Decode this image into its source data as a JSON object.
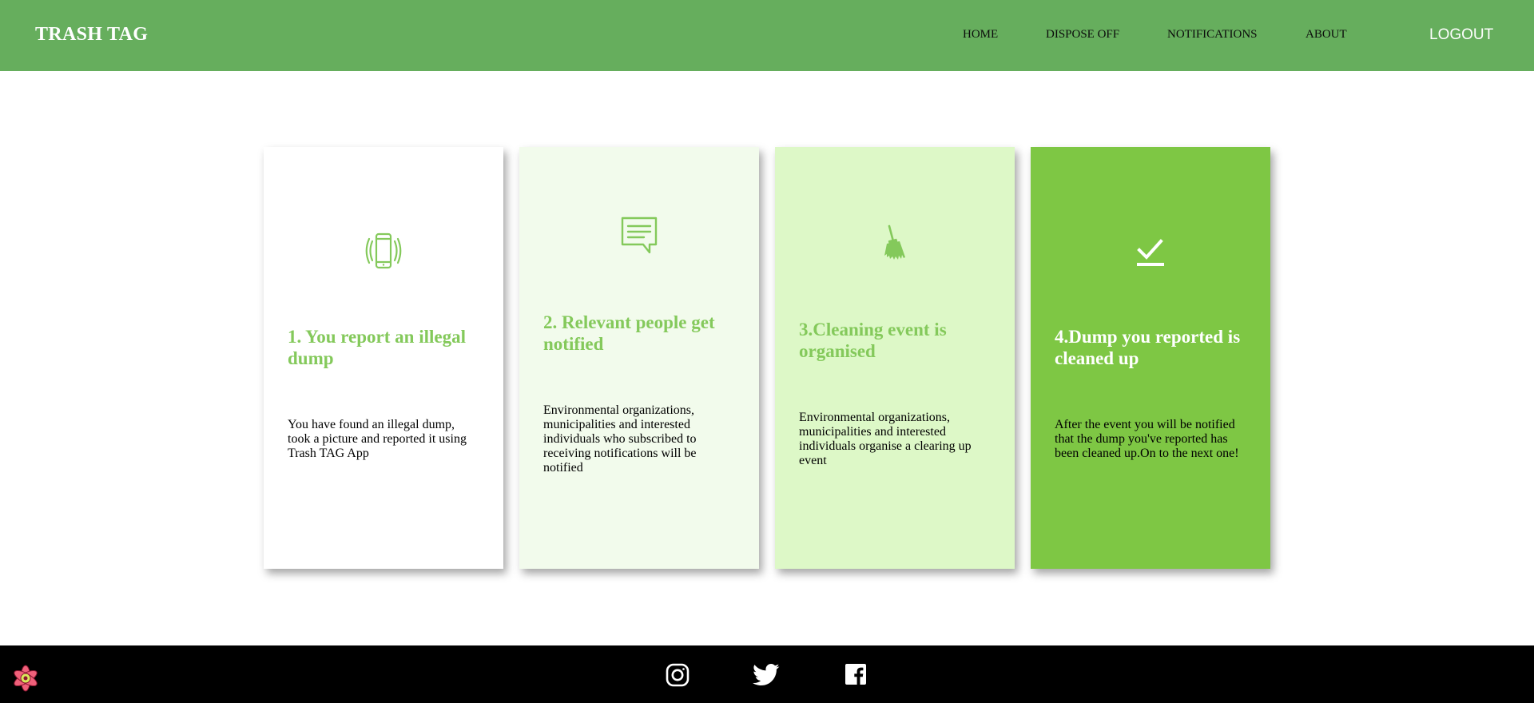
{
  "header": {
    "brand": "TRASH TAG",
    "nav": [
      "HOME",
      "DISPOSE OFF",
      "NOTIFICATIONS",
      "ABOUT"
    ],
    "logout": "LOGOUT"
  },
  "cards": [
    {
      "icon": "vibrating-phone-icon",
      "title": "1. You report an illegal dump",
      "text": "You have found an illegal dump, took a picture and reported it using Trash TAG App",
      "background": "#ffffff"
    },
    {
      "icon": "message-icon",
      "title": "2. Relevant people get notified",
      "text": "Environmental organizations, municipalities and interested individuals who subscribed to receiving notifications will be notified",
      "background": "#f2fbec"
    },
    {
      "icon": "broom-icon",
      "title": "3.Cleaning event is organised",
      "text": "Environmental organizations, municipalities and interested individuals organise a clearing up event",
      "background": "#ddf8c7"
    },
    {
      "icon": "checkmark-icon",
      "title": "4.Dump you reported is cleaned up",
      "text": "After the event you will be notified that the dump you've reported has been cleaned up.On to the next one!",
      "background": "#7ec744"
    }
  ],
  "footer": {
    "social": [
      "instagram-icon",
      "twitter-icon",
      "facebook-icon"
    ],
    "badge": "react-logo-icon"
  },
  "colors": {
    "header": "#66ae5d",
    "accent": "#84c95b",
    "footer": "#000000"
  }
}
